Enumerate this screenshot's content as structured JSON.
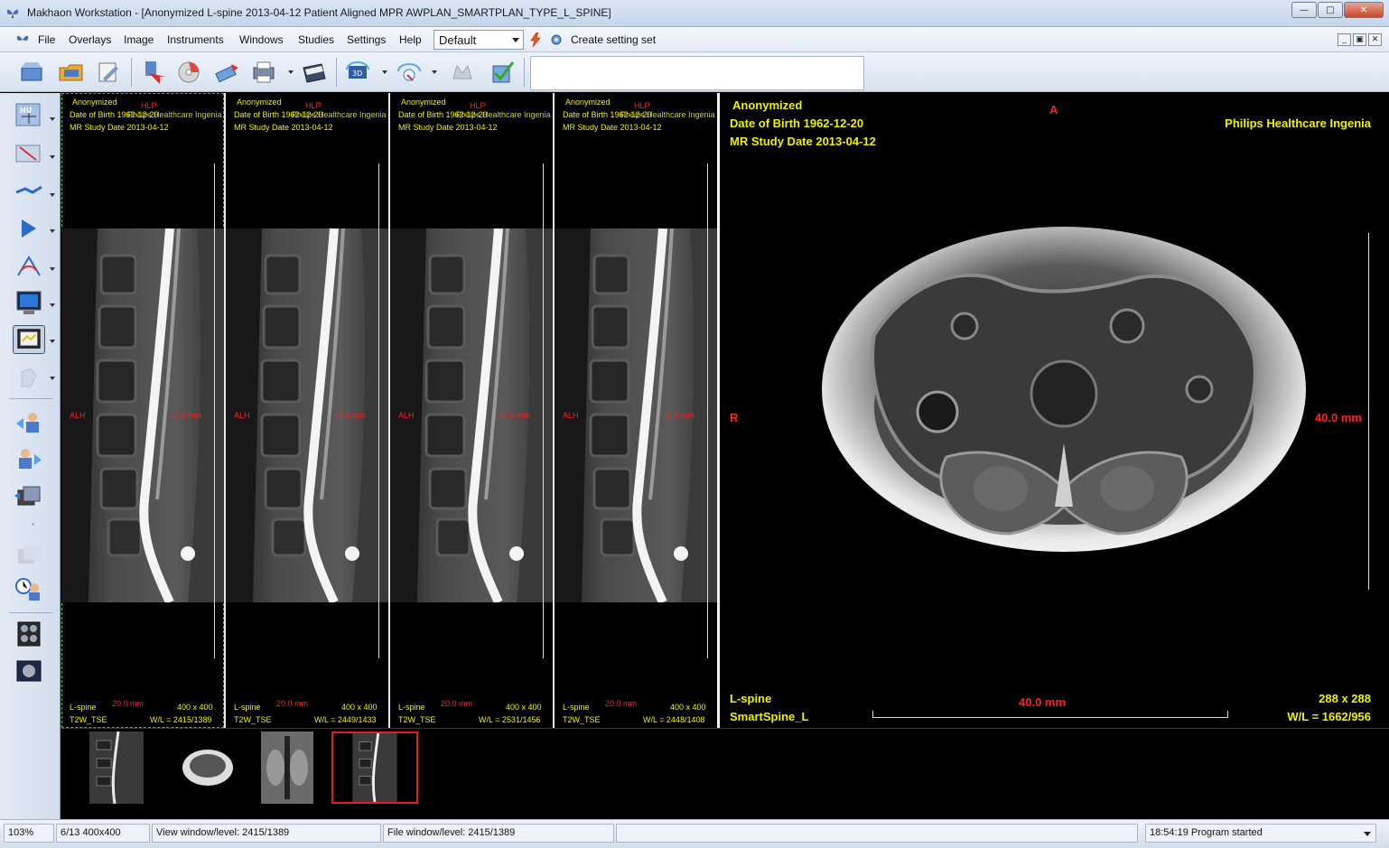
{
  "window": {
    "title": "Makhaon Workstation - [Anonymized L-spine 2013-04-12 Patient Aligned MPR AWPLAN_SMARTPLAN_TYPE_L_SPINE]",
    "minimize": "0",
    "maximize": "1",
    "close": "r"
  },
  "menu": {
    "items": [
      "File",
      "Overlays",
      "Image",
      "Instruments",
      "Windows",
      "Studies",
      "Settings",
      "Help"
    ],
    "preset": "Default",
    "create_setting_set": "Create setting set"
  },
  "panels": [
    {
      "name": "Anonymized",
      "dob": "Date of Birth 1962-12-20",
      "institution": "Philips Healthcare Ingenia",
      "study_date": "MR Study Date 2013-04-12",
      "orient_top": "HLP",
      "orient_left": "ALH",
      "scale_mm": "40.0 mm",
      "series": "L-spine",
      "ruler": "20.0 mm",
      "matrix": "400 x 400",
      "protocol": "T2W_TSE",
      "wl": "W/L = 2415/1389"
    },
    {
      "name": "Anonymized",
      "dob": "Date of Birth 1962-12-20",
      "institution": "Philips Healthcare Ingenia",
      "study_date": "MR Study Date 2013-04-12",
      "orient_top": "HLP",
      "orient_left": "ALH",
      "scale_mm": "40.0 mm",
      "series": "L-spine",
      "ruler": "20.0 mm",
      "matrix": "400 x 400",
      "protocol": "T2W_TSE",
      "wl": "W/L = 2449/1433"
    },
    {
      "name": "Anonymized",
      "dob": "Date of Birth 1962-12-20",
      "institution": "Philips Healthcare Ingenia",
      "study_date": "MR Study Date 2013-04-12",
      "orient_top": "HLP",
      "orient_left": "ALH",
      "scale_mm": "40.0 mm",
      "series": "L-spine",
      "ruler": "20.0 mm",
      "matrix": "400 x 400",
      "protocol": "T2W_TSE",
      "wl": "W/L = 2531/1456"
    },
    {
      "name": "Anonymized",
      "dob": "Date of Birth 1962-12-20",
      "institution": "Philips Healthcare Ingenia",
      "study_date": "MR Study Date 2013-04-12",
      "orient_top": "HLP",
      "orient_left": "ALH",
      "scale_mm": "40.0 mm",
      "series": "L-spine",
      "ruler": "20.0 mm",
      "matrix": "400 x 400",
      "protocol": "T2W_TSE",
      "wl": "W/L = 2448/1408"
    }
  ],
  "main_view": {
    "name": "Anonymized",
    "dob": "Date of Birth 1962-12-20",
    "study_date": "MR Study Date 2013-04-12",
    "institution": "Philips Healthcare Ingenia",
    "orient_top": "A",
    "orient_left": "R",
    "scale_right": "40.0 mm",
    "series": "L-spine",
    "protocol": "SmartSpine_L",
    "ruler": "40.0 mm",
    "matrix": "288 x 288",
    "wl": "W/L = 1662/956"
  },
  "status": {
    "zoom": "103%",
    "image_info": "6/13 400x400",
    "view_wl": "View window/level: 2415/1389",
    "file_wl": "File window/level: 2415/1389",
    "log": "18:54:19 Program started"
  }
}
